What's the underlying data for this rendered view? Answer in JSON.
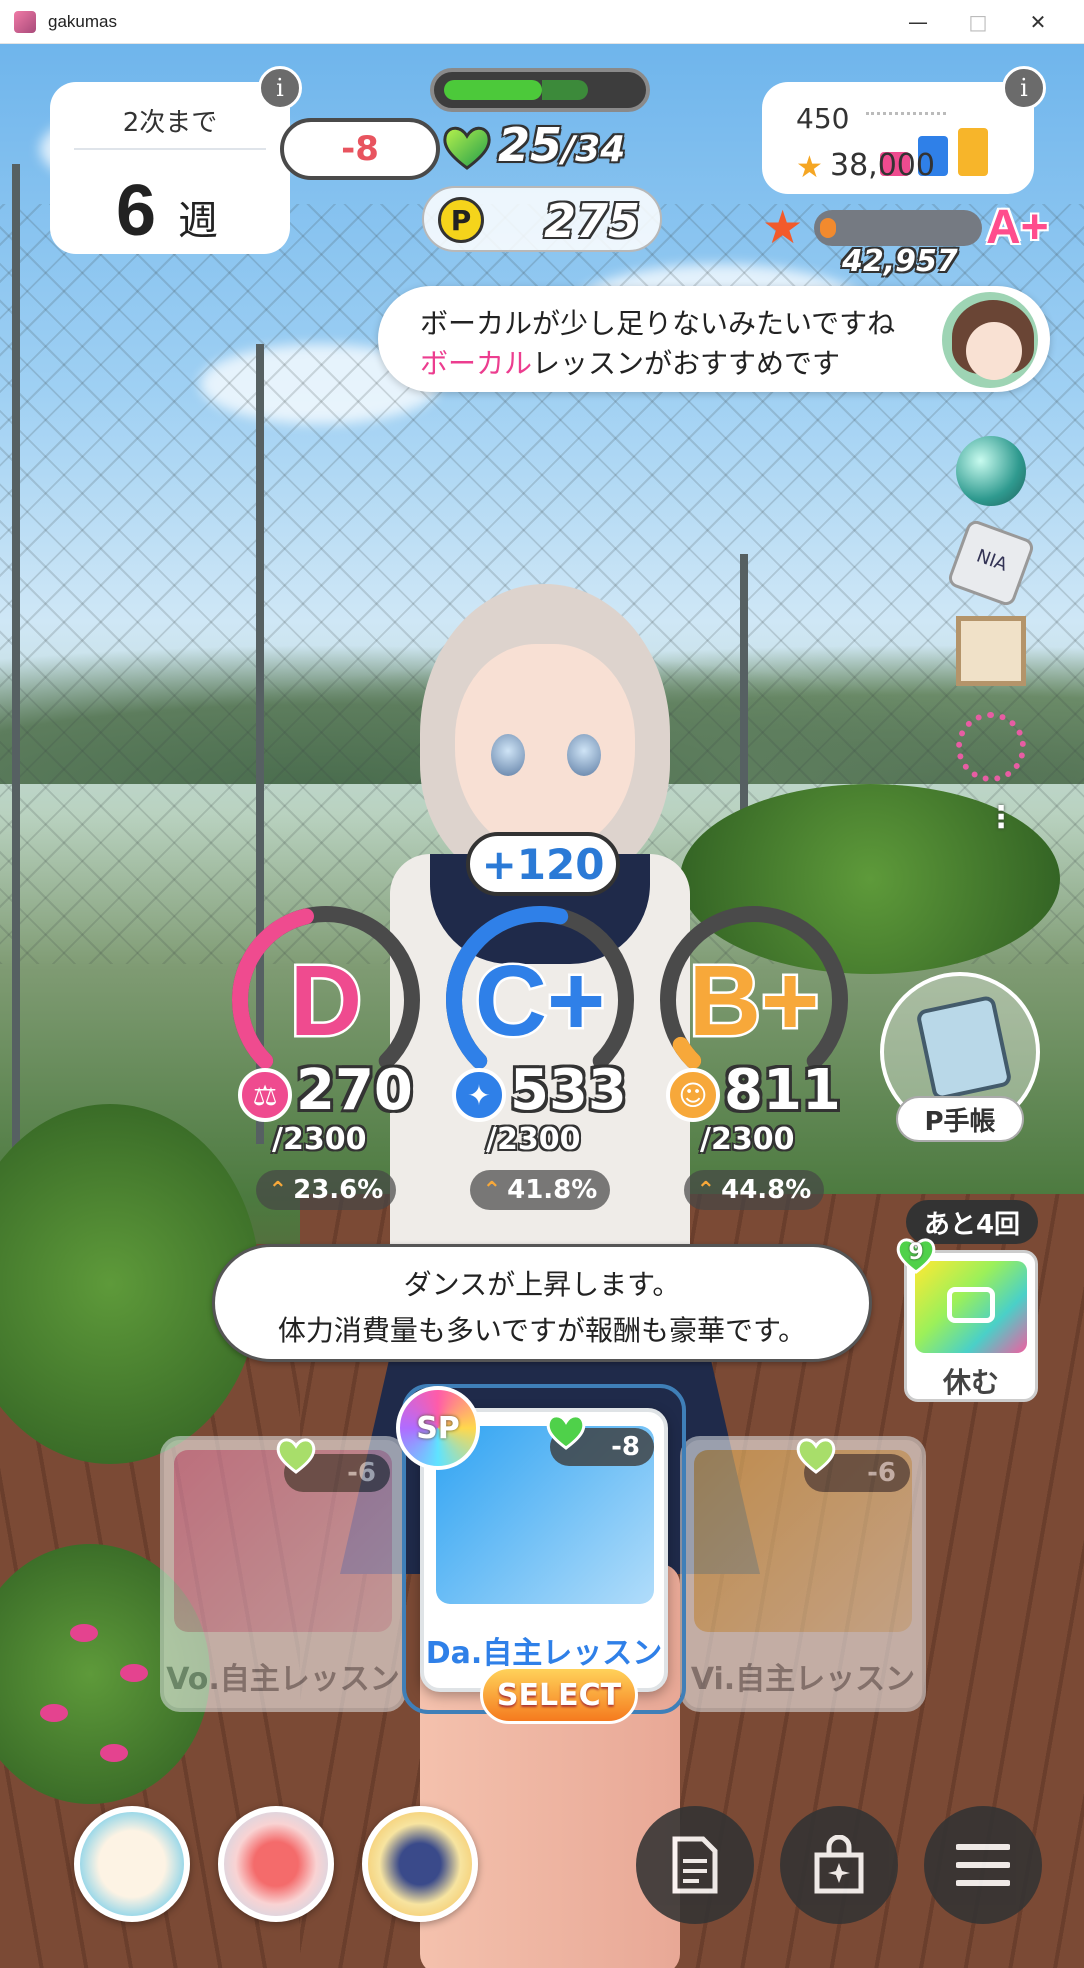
{
  "window": {
    "title": "gakumas",
    "minimize_icon": "minimize-icon",
    "maximize_icon": "maximize-icon",
    "close_icon": "close-icon"
  },
  "exam": {
    "label": "2次まで",
    "value": "6",
    "unit": "週"
  },
  "stamina": {
    "cost": "-8",
    "current": "25",
    "max": "34",
    "current_fraction": 0.735,
    "after_cost_fraction": 0.5,
    "fill_color": "#4cc93a"
  },
  "producer_points": {
    "coin_label": "P",
    "value": "275"
  },
  "rank": {
    "current": "450",
    "target": "38,000",
    "bar_colors": [
      "#ef4b8f",
      "#2f80e8",
      "#f7b52a"
    ],
    "score": "42,957",
    "score_fraction": 0.1,
    "grade": "A+"
  },
  "advice": {
    "line1": "ボーカルが少し足りないみたいですね",
    "line2_highlight": "ボーカル",
    "line2_rest": "レッスンがおすすめです",
    "highlight_color": "#ec3d8f"
  },
  "side_items": [
    "orb-item",
    "nia-tag-item",
    "photo-frame-item",
    "star-charm-item"
  ],
  "gain_bubble": "+120",
  "stats": [
    {
      "key": "vocal",
      "grade": "D",
      "value": "270",
      "max": "/2300",
      "percent": "23.6%",
      "color": "#ef4b8f",
      "icon": "microphone-icon",
      "fill": 0.45
    },
    {
      "key": "dance",
      "grade": "C+",
      "value": "533",
      "max": "/2300",
      "percent": "41.8%",
      "color": "#2f80e8",
      "icon": "dance-shoe-icon",
      "fill": 0.55
    },
    {
      "key": "visual",
      "grade": "B+",
      "value": "811",
      "max": "/2300",
      "percent": "44.8%",
      "color": "#f7a83a",
      "icon": "visual-face-icon",
      "fill": 0.05
    }
  ],
  "notebook_label": "P手帳",
  "rest": {
    "remaining": "あと4回",
    "heart_value": "9",
    "label": "休む"
  },
  "description": {
    "line1": "ダンスが上昇します。",
    "line2": "体力消費量も多いですが報酬も豪華です。"
  },
  "lessons": [
    {
      "label": "Vo.自主レッスン",
      "cost": "-6",
      "color": "#f28fb8"
    },
    {
      "label": "Da.自主レッスン",
      "cost": "-8",
      "color": "#2fa3f2"
    },
    {
      "label": "Vi.自主レッスン",
      "cost": "-6",
      "color": "#f9c262"
    }
  ],
  "sp_badge": "SP",
  "select_label": "SELECT",
  "bottom_items": [
    "drink-cup-item",
    "juice-bottle-item",
    "energy-drink-item"
  ],
  "menu_buttons": [
    "memo-icon",
    "shop-bag-icon",
    "hamburger-menu-icon"
  ]
}
